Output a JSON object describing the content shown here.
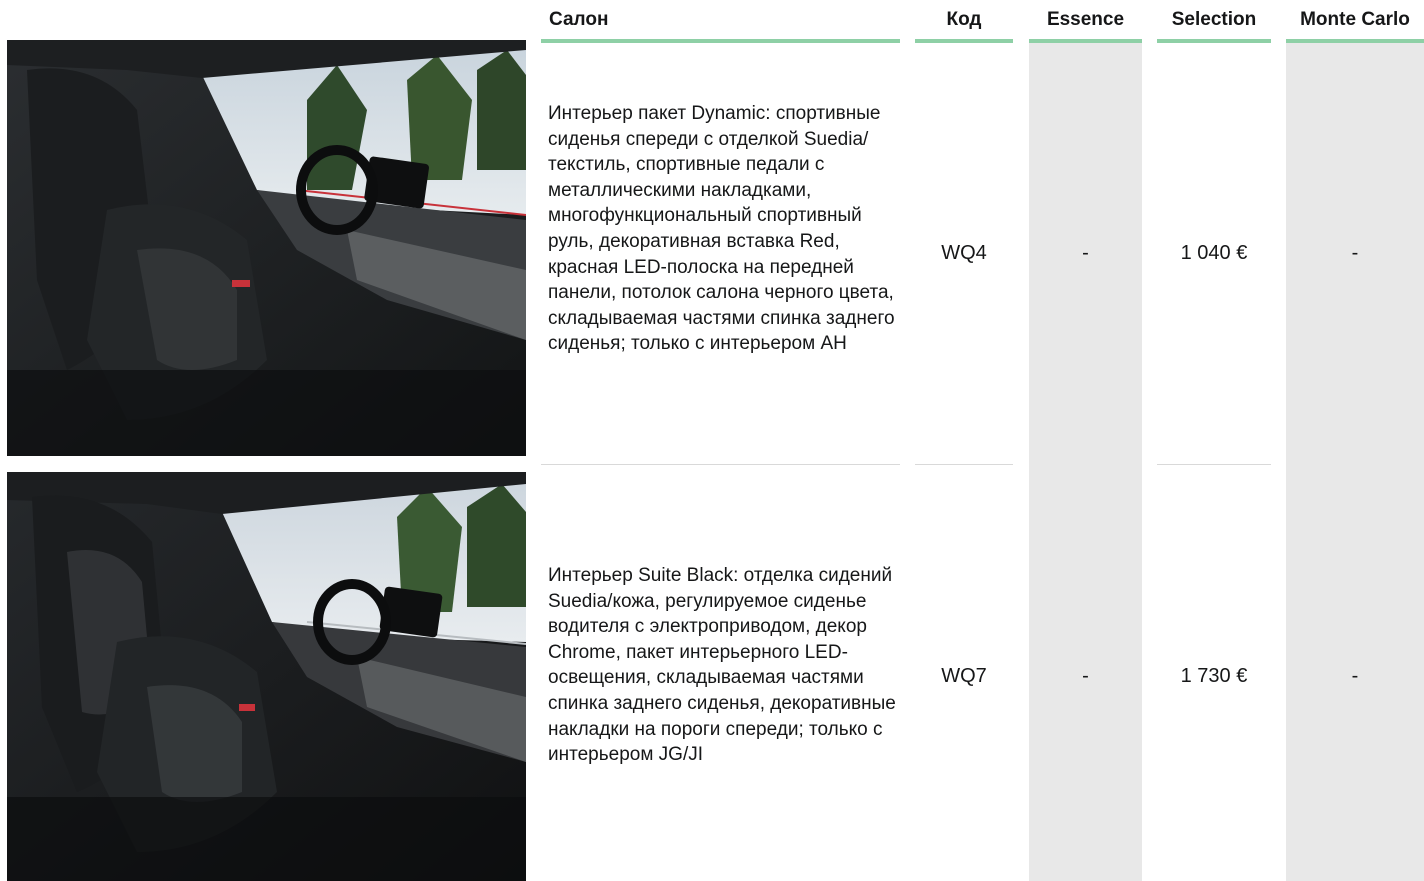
{
  "header": {
    "salon": "Салон",
    "code": "Код",
    "essence": "Essence",
    "selection": "Selection",
    "monte_carlo": "Monte Carlo"
  },
  "rows": [
    {
      "description": "Интерьер пакет Dynamic: спортивные сиденья спереди с отделкой Suedia/текстиль, спортивные педали с металлическими накладками, многофункциональный спортивный руль, декоративная вставка Red, красная LED-полоска на передней панели, потолок салона черного цвета, складываемая частями спинка заднего сиденья; только с интерьером AH",
      "code": "WQ4",
      "essence": "-",
      "selection": "1 040 €",
      "monte_carlo": "-"
    },
    {
      "description": "Интерьер Suite Black:  отделка сидений Suedia/кожа, регулируемое сиденье водителя с электроприводом, декор Chrome, пакет интерьерного LED-освещения, складываемая частями спинка заднего сиденья, декоративные накладки на пороги спереди; только с интерьером JG/JI",
      "code": "WQ7",
      "essence": "-",
      "selection": "1 730 €",
      "monte_carlo": "-"
    }
  ],
  "colors": {
    "accent": "#8ed0a6",
    "shade": "#e8e8e8",
    "text": "#161718"
  }
}
